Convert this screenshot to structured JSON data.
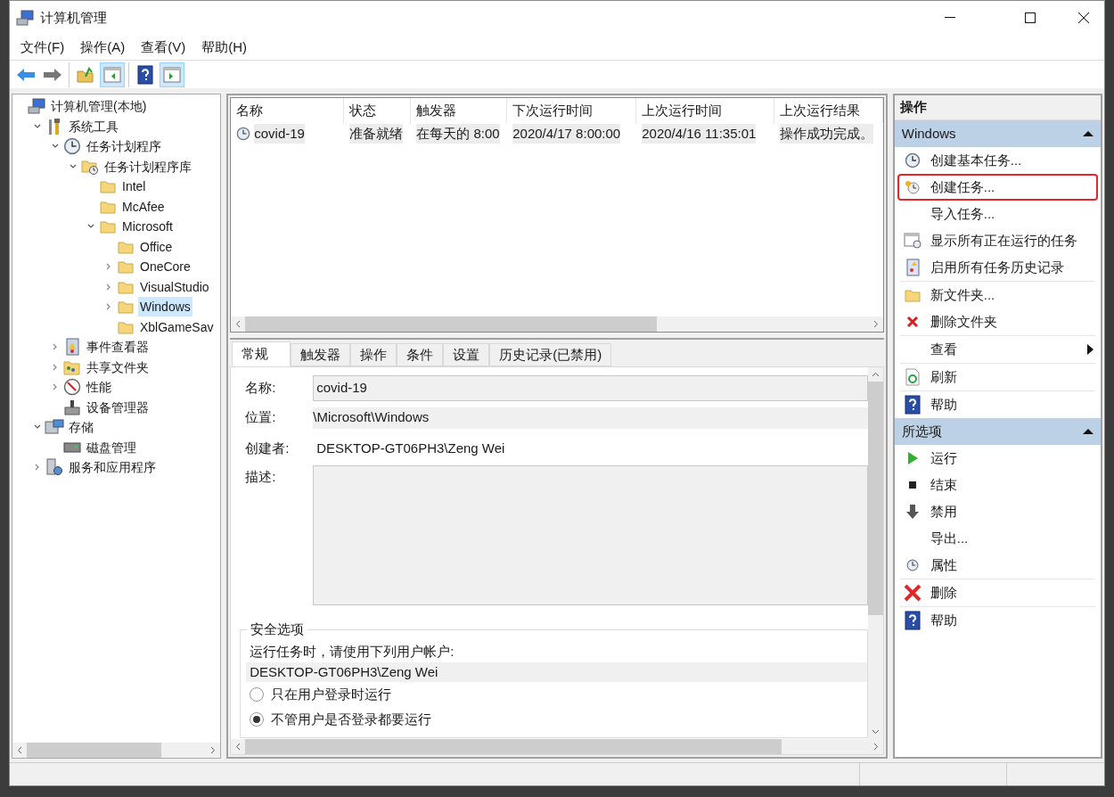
{
  "window": {
    "title": "计算机管理"
  },
  "menu": [
    {
      "label": "文件(F)"
    },
    {
      "label": "操作(A)"
    },
    {
      "label": "查看(V)"
    },
    {
      "label": "帮助(H)"
    }
  ],
  "toolbar": [
    [
      {
        "kind": "back",
        "pressed": false
      },
      {
        "kind": "forward",
        "pressed": false
      }
    ],
    [
      {
        "kind": "up-folder",
        "pressed": false
      },
      {
        "kind": "tree-pane",
        "pressed": true
      }
    ],
    [
      {
        "kind": "help",
        "pressed": false
      },
      {
        "kind": "action-pane",
        "pressed": true
      }
    ]
  ],
  "tree": [
    {
      "label": "计算机管理(本地)",
      "kind": "computer",
      "selected": false,
      "children": [
        {
          "label": "系统工具",
          "kind": "tools",
          "selected": false,
          "expanded": true,
          "children": [
            {
              "label": "任务计划程序",
              "kind": "clock",
              "selected": false,
              "expanded": true,
              "children": [
                {
                  "label": "任务计划程序库",
                  "kind": "task-folder",
                  "selected": false,
                  "expanded": true,
                  "children": [
                    {
                      "label": "Intel",
                      "kind": "folder",
                      "selected": false
                    },
                    {
                      "label": "McAfee",
                      "kind": "folder",
                      "selected": false
                    },
                    {
                      "label": "Microsoft",
                      "kind": "folder",
                      "selected": false,
                      "expanded": true,
                      "children": [
                        {
                          "label": "Office",
                          "kind": "folder",
                          "selected": false
                        },
                        {
                          "label": "OneCore",
                          "kind": "folder",
                          "selected": false,
                          "expanded": false
                        },
                        {
                          "label": "VisualStudio",
                          "kind": "folder",
                          "selected": false,
                          "expanded": false
                        },
                        {
                          "label": "Windows",
                          "kind": "folder",
                          "selected": true,
                          "expanded": false
                        },
                        {
                          "label": "XblGameSav",
                          "kind": "folder",
                          "selected": false
                        }
                      ]
                    }
                  ]
                }
              ]
            },
            {
              "label": "事件查看器",
              "kind": "event",
              "selected": false,
              "expanded": false
            },
            {
              "label": "共享文件夹",
              "kind": "shared",
              "selected": false,
              "expanded": false
            },
            {
              "label": "性能",
              "kind": "performance",
              "selected": false,
              "expanded": false
            },
            {
              "label": "设备管理器",
              "kind": "device",
              "selected": false
            }
          ]
        },
        {
          "label": "存储",
          "kind": "storage",
          "selected": false,
          "expanded": true,
          "children": [
            {
              "label": "磁盘管理",
              "kind": "disk",
              "selected": false
            }
          ]
        },
        {
          "label": "服务和应用程序",
          "kind": "services",
          "selected": false,
          "expanded": false
        }
      ]
    }
  ],
  "task_list": {
    "columns": [
      "名称",
      "状态",
      "触发器",
      "下次运行时间",
      "上次运行时间",
      "上次运行结果"
    ],
    "rows": [
      {
        "selected": true,
        "cells": [
          "covid-19",
          "准备就绪",
          "在每天的 8:00",
          "2020/4/17 8:00:00",
          "2020/4/16 11:35:01",
          "操作成功完成。"
        ]
      }
    ]
  },
  "details": {
    "tabs": [
      {
        "label": "常规",
        "selected": true
      },
      {
        "label": "触发器",
        "selected": false
      },
      {
        "label": "操作",
        "selected": false
      },
      {
        "label": "条件",
        "selected": false
      },
      {
        "label": "设置",
        "selected": false
      },
      {
        "label": "历史记录(已禁用)",
        "selected": false
      }
    ],
    "fields": [
      {
        "label": "名称:",
        "kind": "textbox",
        "value": "covid-19"
      },
      {
        "label": "位置:",
        "kind": "readonly",
        "value": "\\Microsoft\\Windows"
      },
      {
        "label": "创建者:",
        "kind": "plain",
        "value": "DESKTOP-GT06PH3\\Zeng Wei"
      },
      {
        "label": "描述:",
        "kind": "textarea"
      }
    ],
    "security": {
      "title": "安全选项",
      "prompt": "运行任务时，请使用下列用户帐户:",
      "account": "DESKTOP-GT06PH3\\Zeng Wei",
      "options": [
        {
          "label": "只在用户登录时运行",
          "selected": false
        },
        {
          "label": "不管用户是否登录都要运行",
          "selected": true
        }
      ]
    }
  },
  "actions": {
    "title": "操作",
    "sections": [
      {
        "title": "Windows",
        "expanded": true,
        "groups": [
          [
            {
              "label": "创建基本任务...",
              "kind": "create-basic",
              "submenu": false,
              "highlighted": false
            },
            {
              "label": "创建任务...",
              "kind": "create",
              "submenu": false,
              "highlighted": true
            },
            {
              "label": "导入任务...",
              "kind": "plain",
              "submenu": false,
              "highlighted": false
            },
            {
              "label": "显示所有正在运行的任务",
              "kind": "running",
              "submenu": false,
              "highlighted": false
            },
            {
              "label": "启用所有任务历史记录",
              "kind": "history",
              "submenu": false,
              "highlighted": false
            }
          ],
          [
            {
              "label": "新文件夹...",
              "kind": "new-folder",
              "submenu": false,
              "highlighted": false
            },
            {
              "label": "删除文件夹",
              "kind": "delete-small",
              "submenu": false,
              "highlighted": false
            }
          ],
          [
            {
              "label": "查看",
              "kind": "plain",
              "submenu": true,
              "highlighted": false
            }
          ],
          [
            {
              "label": "刷新",
              "kind": "refresh",
              "submenu": false,
              "highlighted": false
            }
          ],
          [
            {
              "label": "帮助",
              "kind": "help",
              "submenu": false,
              "highlighted": false
            }
          ]
        ]
      },
      {
        "title": "所选项",
        "expanded": true,
        "groups": [
          [
            {
              "label": "运行",
              "kind": "run",
              "submenu": false,
              "highlighted": false
            },
            {
              "label": "结束",
              "kind": "stop",
              "submenu": false,
              "highlighted": false
            },
            {
              "label": "禁用",
              "kind": "disable",
              "submenu": false,
              "highlighted": false
            },
            {
              "label": "导出...",
              "kind": "plain",
              "submenu": false,
              "highlighted": false
            },
            {
              "label": "属性",
              "kind": "properties",
              "submenu": false,
              "highlighted": false
            }
          ],
          [
            {
              "label": "删除",
              "kind": "delete",
              "submenu": false,
              "highlighted": false
            }
          ],
          [
            {
              "label": "帮助",
              "kind": "help",
              "submenu": false,
              "highlighted": false
            }
          ]
        ]
      }
    ]
  }
}
